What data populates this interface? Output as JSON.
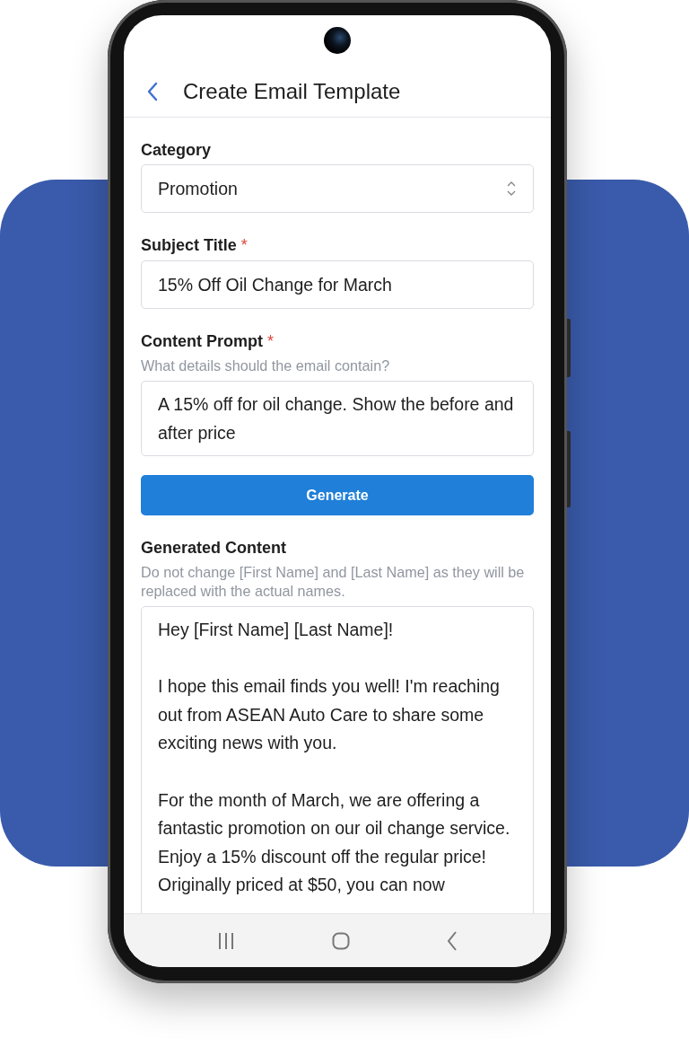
{
  "header": {
    "title": "Create Email Template"
  },
  "fields": [
    {
      "kind": "select",
      "label": "Category",
      "value": "Promotion"
    },
    {
      "kind": "input",
      "label": "Subject Title",
      "required_mark": "*",
      "value": "15% Off Oil Change for March"
    },
    {
      "kind": "textarea",
      "label": "Content Prompt",
      "required_mark": "*",
      "hint": "What details should the email contain?",
      "value": "A 15% off for oil change. Show the before and after price"
    }
  ],
  "generate_button": "Generate",
  "generated": {
    "label": "Generated Content",
    "hint": "Do not change [First Name] and [Last Name] as they will be replaced with the actual names.",
    "value": "Hey [First Name] [Last Name]!\n\nI hope this email finds you well! I'm reaching out from ASEAN Auto Care to share some exciting news with you.\n\nFor the month of March, we are offering a fantastic promotion on our oil change service. Enjoy a 15% discount off the regular price! Originally priced at $50, you can now"
  }
}
